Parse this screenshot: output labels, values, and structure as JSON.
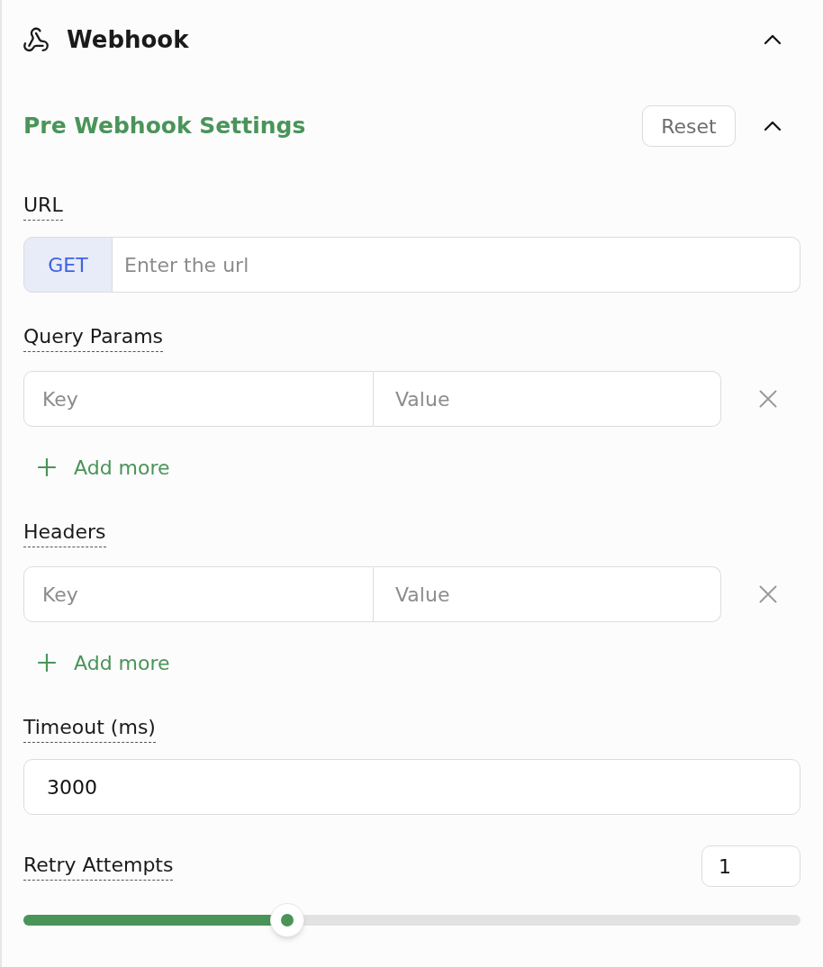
{
  "panel": {
    "title": "Webhook",
    "expanded": true
  },
  "section": {
    "title": "Pre Webhook Settings",
    "reset_button": "Reset",
    "expanded": true
  },
  "fields": [
    {
      "kind": "url",
      "label": "URL",
      "method": "GET",
      "placeholder": "Enter the url"
    },
    {
      "kind": "pairs",
      "label": "Query Params",
      "rows": [
        {
          "key_placeholder": "Key",
          "value_placeholder": "Value"
        }
      ],
      "add_button": "Add more"
    },
    {
      "kind": "pairs",
      "label": "Headers",
      "rows": [
        {
          "key_placeholder": "Key",
          "value_placeholder": "Value"
        }
      ],
      "add_button": "Add more"
    },
    {
      "kind": "text",
      "label": "Timeout (ms)",
      "value": "3000"
    },
    {
      "kind": "slider",
      "label": "Retry Attempts",
      "value": "1",
      "level": 0.34
    }
  ]
}
